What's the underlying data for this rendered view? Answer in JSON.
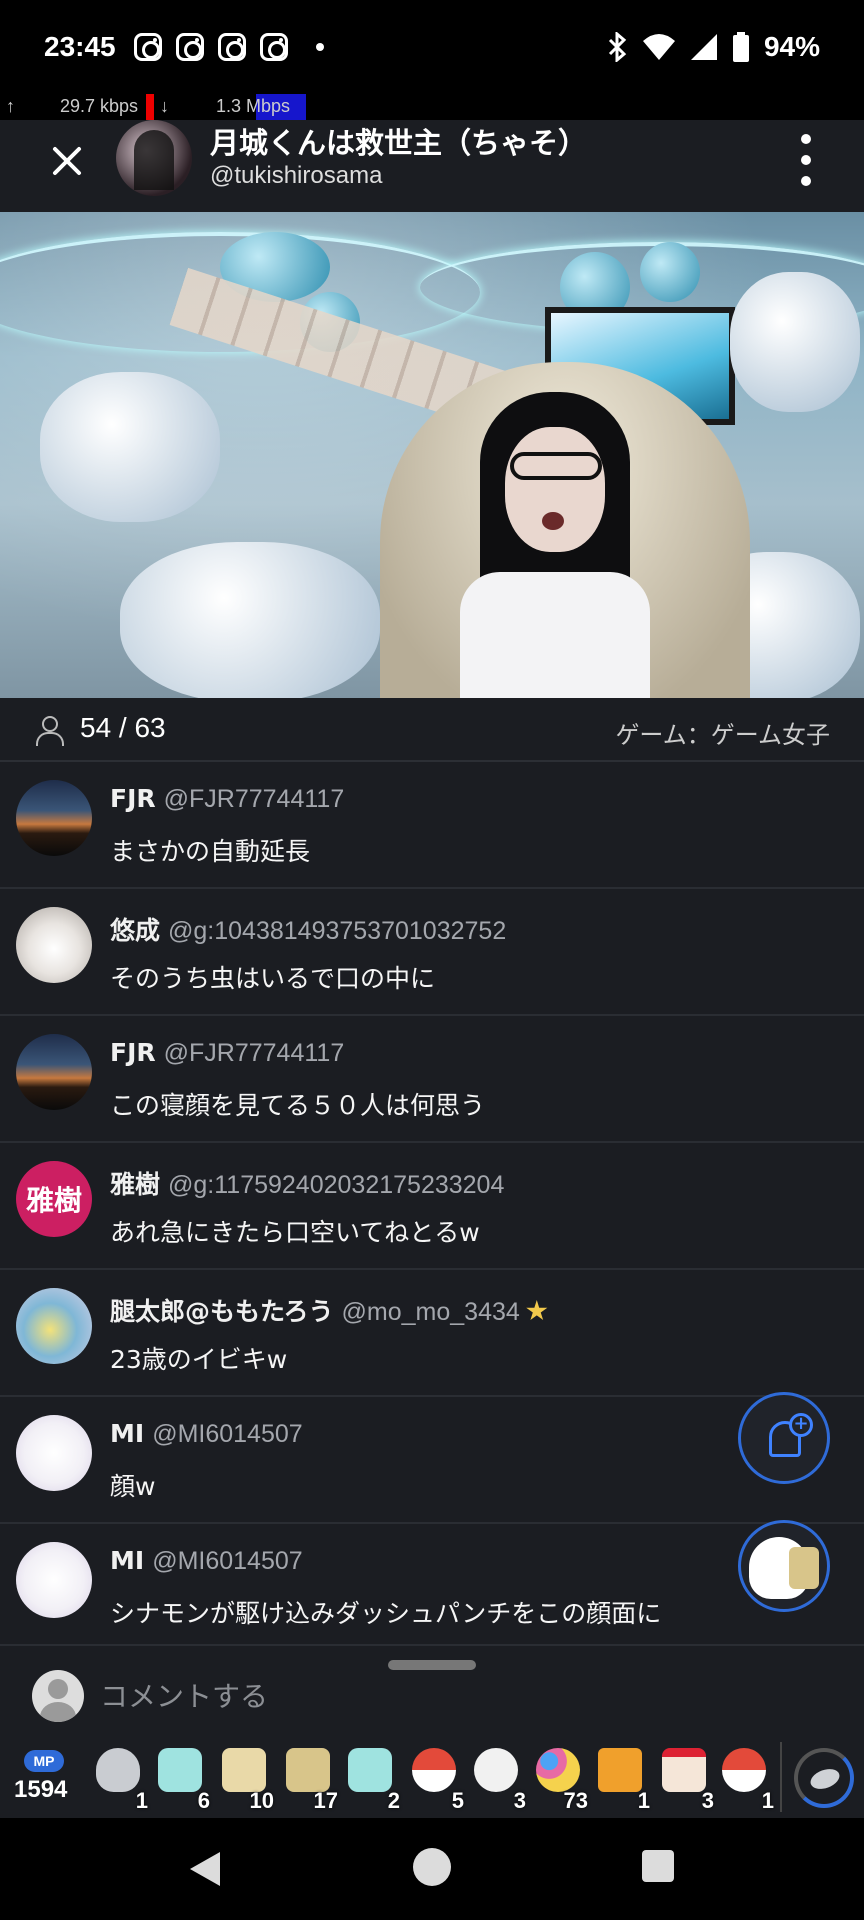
{
  "status": {
    "time": "23:45",
    "battery": "94%"
  },
  "net": {
    "up": "29.7 kbps",
    "down": "1.3 Mbps"
  },
  "header": {
    "name": "月城くんは救世主（ちゃそ）",
    "handle": "@tukishirosama"
  },
  "stream": {
    "viewers": "54 / 63",
    "category": "ゲーム：ゲーム女子"
  },
  "comments": [
    {
      "name": "FJR",
      "handle": "@FJR77744117",
      "text": "まさかの自動延長",
      "avatar": "sunset"
    },
    {
      "name": "悠成",
      "handle": "@g:104381493753701032752",
      "text": "そのうち虫はいるで口の中に",
      "avatar": "cat"
    },
    {
      "name": "FJR",
      "handle": "@FJR77744117",
      "text": "この寝顔を見てる５０人は何思う",
      "avatar": "sunset"
    },
    {
      "name": "雅樹",
      "handle": "@g:117592402032175233204",
      "text": "あれ急にきたら口空いてねとるw",
      "avatar": "text",
      "avatar_text": "雅樹",
      "avatar_color": "#cc1f62"
    },
    {
      "name": "腿太郎@ももたろう",
      "handle": "@mo_mo_3434",
      "text": "23歳のイビキw",
      "avatar": "bird",
      "badge": "star-badge-icon"
    },
    {
      "name": "MI",
      "handle": "@MI6014507",
      "text": "顔w",
      "avatar": "flower"
    },
    {
      "name": "MI",
      "handle": "@MI6014507",
      "text": "シナモンが駆け込みダッシュパンチをこの顔面に",
      "avatar": "flower"
    }
  ],
  "composer": {
    "placeholder": "コメントする"
  },
  "gifts": {
    "mp_label": "MP",
    "mp_count": "1594",
    "items": [
      {
        "icon": "coin-icon",
        "count": "1",
        "color": "#c9ccd1"
      },
      {
        "icon": "ghost-card-icon",
        "count": "6",
        "color": "#9fe3e0"
      },
      {
        "icon": "sake-icon",
        "count": "10",
        "color": "#e9d9a8"
      },
      {
        "icon": "tea-icon",
        "count": "17",
        "color": "#d8c58a"
      },
      {
        "icon": "ghost-card-icon",
        "count": "2",
        "color": "#9fe3e0"
      },
      {
        "icon": "santa-icon",
        "count": "5",
        "color": "#e34a3a"
      },
      {
        "icon": "penguin-icon",
        "count": "3",
        "color": "#f1f1f1"
      },
      {
        "icon": "balloons-icon",
        "count": "73",
        "color": "#e76aa4"
      },
      {
        "icon": "present-icon",
        "count": "1",
        "color": "#f0a02c"
      },
      {
        "icon": "cake-icon",
        "count": "3",
        "color": "#f5e6d8"
      },
      {
        "icon": "santa-icon",
        "count": "1",
        "color": "#e34a3a"
      }
    ]
  },
  "colors": {
    "accent": "#2f6bd8",
    "panel": "#1b1d22",
    "avatar_masaki": "#cc1f62"
  }
}
